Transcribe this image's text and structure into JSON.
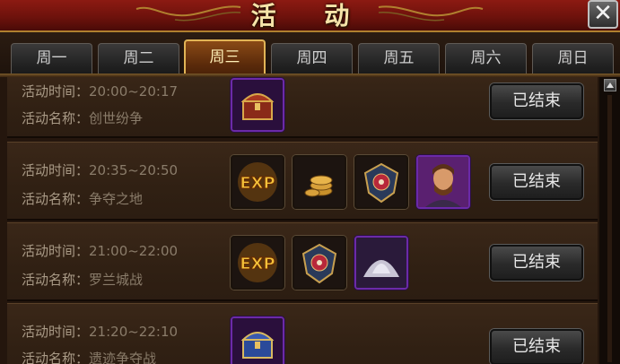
{
  "window": {
    "title": "活 动",
    "close_glyph": "✕"
  },
  "tabs": [
    {
      "label": "周一",
      "active": false
    },
    {
      "label": "周二",
      "active": false
    },
    {
      "label": "周三",
      "active": true
    },
    {
      "label": "周四",
      "active": false
    },
    {
      "label": "周五",
      "active": false
    },
    {
      "label": "周六",
      "active": false
    },
    {
      "label": "周日",
      "active": false
    }
  ],
  "time_label": "活动时间：",
  "name_label": "活动名称：",
  "events": [
    {
      "time": "20:00~20:17",
      "name": "创世纷争",
      "status": "已结束",
      "rewards": [
        {
          "icon": "treasure-chest-icon",
          "rarity": "purple"
        }
      ]
    },
    {
      "time": "20:35~20:50",
      "name": "争夺之地",
      "status": "已结束",
      "rewards": [
        {
          "icon": "exp-icon",
          "rarity": "normal"
        },
        {
          "icon": "gold-coins-icon",
          "rarity": "normal"
        },
        {
          "icon": "crest-emblem-icon",
          "rarity": "normal"
        },
        {
          "icon": "hero-portrait-icon",
          "rarity": "purple"
        }
      ]
    },
    {
      "time": "21:00~22:00",
      "name": "罗兰城战",
      "status": "已结束",
      "rewards": [
        {
          "icon": "exp-icon",
          "rarity": "normal"
        },
        {
          "icon": "crest-emblem-icon",
          "rarity": "normal"
        },
        {
          "icon": "silver-powder-icon",
          "rarity": "purple"
        }
      ]
    },
    {
      "time": "21:20~22:10",
      "name": "遗迹争夺战",
      "status": "已结束",
      "rewards": [
        {
          "icon": "blue-chest-icon",
          "rarity": "purple"
        }
      ]
    }
  ],
  "colors": {
    "title_bar": "#6e120c",
    "active_tab": "#e2b456",
    "rare_border": "#6b2aa8"
  }
}
